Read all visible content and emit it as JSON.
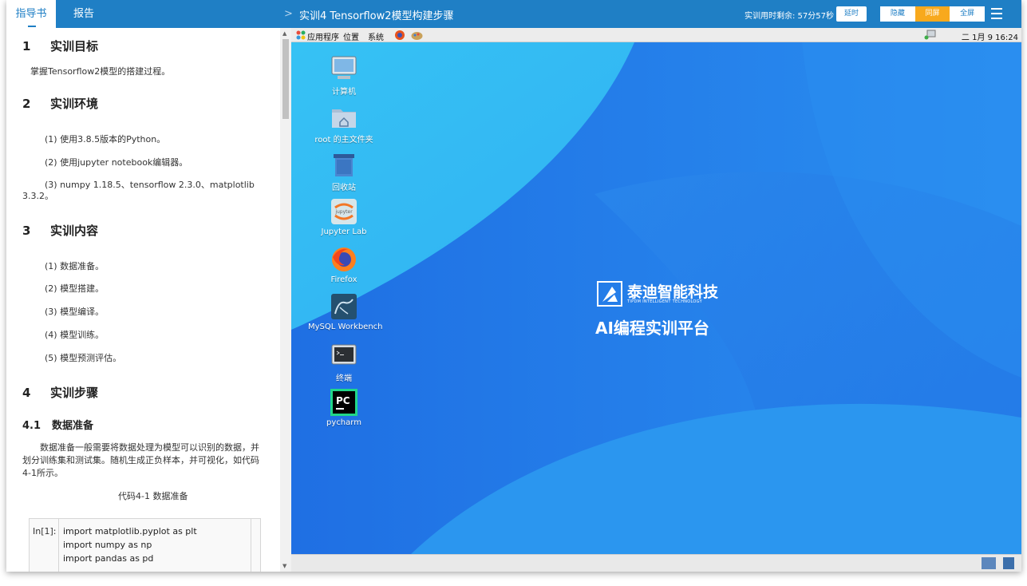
{
  "topbar": {
    "tabs": [
      {
        "label": "指导书"
      },
      {
        "label": "报告"
      }
    ],
    "title": "实训4 Tensorflow2模型构建步骤",
    "timer": "实训用时剩余: 57分57秒",
    "extend_label": "延时",
    "view_modes": [
      "隐藏",
      "同屏",
      "全屏"
    ],
    "active_view": "同屏",
    "accent": "#1f7fc5",
    "active_color": "#f8a91d"
  },
  "guide": {
    "s1": {
      "num": "1",
      "title": "实训目标",
      "text": "掌握Tensorflow2模型的搭建过程。"
    },
    "s2": {
      "num": "2",
      "title": "实训环境",
      "items": [
        "(1)  使用3.8.5版本的Python。",
        "(2)  使用jupyter notebook编辑器。",
        "(3)  numpy 1.18.5、tensorflow 2.3.0、matplotlib"
      ],
      "wrap": "3.3.2。"
    },
    "s3": {
      "num": "3",
      "title": "实训内容",
      "items": [
        "(1)  数据准备。",
        "(2)  模型搭建。",
        "(3)  模型编译。",
        "(4)  模型训练。",
        "(5)  模型预测评估。"
      ]
    },
    "s4": {
      "num": "4",
      "title": "实训步骤"
    },
    "s41": {
      "num": "4.1",
      "title": "数据准备",
      "lines": [
        "数据准备一般需要将数据处理为模型可以识别的数据，并",
        "划分训练集和测试集。随机生成正负样本，并可视化，如代码",
        "4-1所示。"
      ]
    },
    "caption": "代码4-1 数据准备",
    "code": {
      "label": "In[1]:",
      "lines": [
        "import matplotlib.pyplot as plt",
        "import numpy as np",
        "import pandas as pd"
      ]
    }
  },
  "desktop": {
    "panel": {
      "apps": "应用程序",
      "places": "位置",
      "system": "系统",
      "clock": "二 1月  9 16:24"
    },
    "icons": [
      {
        "label": "计算机",
        "icon": "computer-icon"
      },
      {
        "label": "root 的主文件夹",
        "icon": "home-folder-icon"
      },
      {
        "label": "回收站",
        "icon": "trash-icon"
      },
      {
        "label": "Jupyter Lab",
        "icon": "jupyter-icon",
        "badge": "jupyter"
      },
      {
        "label": "Firefox",
        "icon": "firefox-icon"
      },
      {
        "label": "MySQL Workbench",
        "icon": "mysql-workbench-icon"
      },
      {
        "label": "终端",
        "icon": "terminal-icon"
      },
      {
        "label": "pycharm",
        "icon": "pycharm-icon",
        "badge": "PC"
      }
    ],
    "brand": {
      "name": "泰迪智能科技",
      "sub": "TIPDM INTELLIGENT TECHNOLOGY",
      "slogan": "AI编程实训平台"
    }
  }
}
